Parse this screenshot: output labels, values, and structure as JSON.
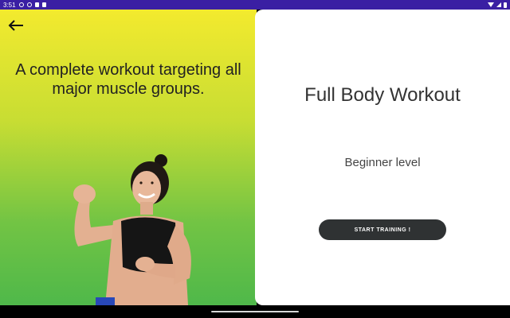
{
  "status_bar": {
    "time": "3:51",
    "icons_left": [
      "alarm-icon",
      "vpn-icon",
      "sim-icon",
      "notification-icon"
    ],
    "icons_right": [
      "wifi-icon",
      "signal-icon",
      "battery-icon"
    ]
  },
  "left_panel": {
    "back_icon": "arrow-left-icon",
    "tagline": "A complete workout targeting all major muscle groups.",
    "gradient_colors": [
      "#f3ea2e",
      "#c7dd33",
      "#72c444",
      "#4fb84a"
    ]
  },
  "card": {
    "title": "Full Body Workout",
    "level": "Beginner level",
    "start_button_label": "START TRAINING !"
  },
  "colors": {
    "status_bar": "#3a1fa3",
    "button": "#2f3233",
    "card_bg": "#ffffff"
  }
}
